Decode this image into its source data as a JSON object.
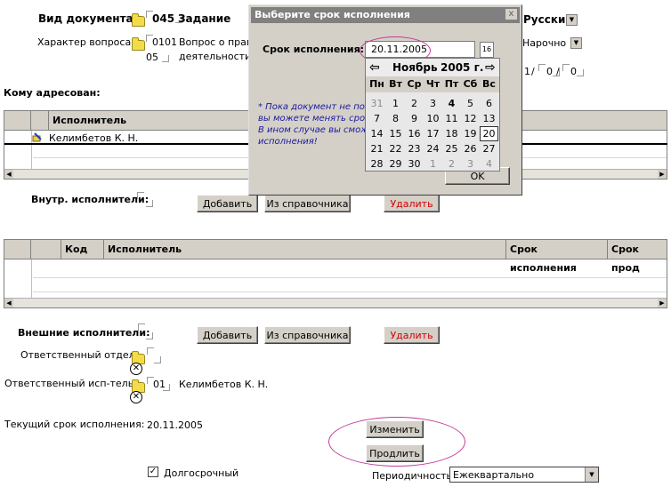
{
  "doc": {
    "vid_label": "Вид документа:",
    "vid_code": "045",
    "vid_name": "Задание",
    "char_label": "Характер вопроса:",
    "char_code_1": "0101",
    "char_code_2": "05",
    "char_text_1": "Вопрос о право",
    "char_text_2": "деятельности",
    "lang_value": "Русский",
    "delivery_value": "Нарочно",
    "num_1": "1",
    "num_2": "0",
    "num_3": "0"
  },
  "addressed": {
    "label": "Кому адресован:",
    "col_executor": "Исполнитель",
    "row_name": "Келимбетов К. Н."
  },
  "internal": {
    "label": "Внутр. исполнители:",
    "add": "Добавить",
    "from_dir": "Из справочника",
    "delete": "Удалить"
  },
  "internal_grid": {
    "col_code": "Код",
    "col_executor": "Исполнитель",
    "col_deadline": "Срок исполнения",
    "col_ext": "Срок прод"
  },
  "external": {
    "label": "Внешние исполнители:",
    "add": "Добавить",
    "from_dir": "Из справочника",
    "delete": "Удалить"
  },
  "resp": {
    "dept_label": "Ответственный отдел:",
    "exec_label": "Ответственный исп-тель:",
    "exec_code": "01",
    "exec_name": "Келимбетов К. Н."
  },
  "deadline": {
    "label": "Текущий срок исполнения:",
    "value": "20.11.2005",
    "change": "Изменить",
    "extend": "Продлить"
  },
  "longterm": {
    "label": "Долгосрочный",
    "checked": true
  },
  "periodicity": {
    "label": "Периодичность:",
    "value": "Ежеквартально"
  },
  "dialog": {
    "title": "Выберите срок исполнения",
    "field_label": "Срок исполнения:",
    "date_value": "20.11.2005",
    "cal_btn": "16",
    "note_1": "* Пока документ не пол",
    "note_2": "вы можете менять срок",
    "note_3": "В ином случае вы сможе",
    "note_4": "исполнения!",
    "ok": "OK",
    "close": "x"
  },
  "calendar": {
    "month": "Ноябрь",
    "year": "2005 г.",
    "prev": "⇦",
    "next": "⇨",
    "weekdays": [
      "Пн",
      "Вт",
      "Ср",
      "Чт",
      "Пт",
      "Сб",
      "Вс"
    ],
    "weeks": [
      [
        "31",
        "1",
        "2",
        "3",
        "4",
        "5",
        "6"
      ],
      [
        "7",
        "8",
        "9",
        "10",
        "11",
        "12",
        "13"
      ],
      [
        "14",
        "15",
        "16",
        "17",
        "18",
        "19",
        "20"
      ],
      [
        "21",
        "22",
        "23",
        "24",
        "25",
        "26",
        "27"
      ],
      [
        "28",
        "29",
        "30",
        "1",
        "2",
        "3",
        "4"
      ]
    ],
    "selected": "20",
    "today": "4"
  },
  "colors": {
    "window_bg": "#d4d0c8",
    "highlight": "#c2389a",
    "note_text": "#1a1a9a",
    "delete_text": "#d40000"
  }
}
